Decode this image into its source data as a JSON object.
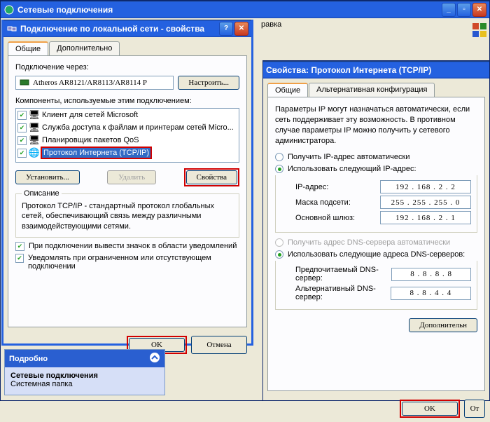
{
  "main_window": {
    "title": "Сетевые подключения",
    "menu_item": "равка"
  },
  "conn_window": {
    "title": "Подключение по локальной сети - свойства",
    "tabs": {
      "general": "Общие",
      "advanced": "Дополнительно"
    },
    "connect_via_label": "Подключение через:",
    "adapter": "Atheros AR8121/AR8113/AR8114 P",
    "configure_btn": "Настроить...",
    "components_label": "Компоненты, используемые этим подключением:",
    "items": [
      "Клиент для сетей Microsoft",
      "Служба доступа к файлам и принтерам сетей Micro...",
      "Планировщик пакетов QoS",
      "Протокол Интернета (TCP/IP)"
    ],
    "install_btn": "Установить...",
    "uninstall_btn": "Удалить",
    "properties_btn": "Свойства",
    "description_label": "Описание",
    "description_text": "Протокол TCP/IP - стандартный протокол глобальных сетей, обеспечивающий связь между различными взаимодействующими сетями.",
    "chk_notify": "При подключении вывести значок в области уведомлений",
    "chk_limited": "Уведомлять при ограниченном или отсутствующем подключении",
    "ok_btn": "OK",
    "cancel_btn": "Отмена"
  },
  "tcpip_window": {
    "title": "Свойства: Протокол Интернета (TCP/IP)",
    "tabs": {
      "general": "Общие",
      "alt": "Альтернативная конфигурация"
    },
    "intro": "Параметры IP могут назначаться автоматически, если сеть поддерживает эту возможность. В противном случае параметры IP можно получить у сетевого администратора.",
    "radio_auto_ip": "Получить IP-адрес автоматически",
    "radio_manual_ip": "Использовать следующий IP-адрес:",
    "ip_label": "IP-адрес:",
    "ip_value": "192 . 168 .  2  .  2",
    "mask_label": "Маска подсети:",
    "mask_value": "255 . 255 . 255 .  0",
    "gateway_label": "Основной шлюз:",
    "gateway_value": "192 . 168 .  2  .  1",
    "radio_auto_dns": "Получить адрес DNS-сервера автоматически",
    "radio_manual_dns": "Использовать следующие адреса DNS-серверов:",
    "dns1_label": "Предпочитаемый DNS-сервер:",
    "dns1_value": "8  .  8  .  8  .  8",
    "dns2_label": "Альтернативный DNS-сервер:",
    "dns2_value": "8  .  8  .  4  .  4",
    "advanced_btn": "Дополнительн",
    "ok_btn": "OK",
    "cancel_btn": "От"
  },
  "folder_panel": {
    "header": "Подробно",
    "title": "Сетевые подключения",
    "subtitle": "Системная папка"
  }
}
